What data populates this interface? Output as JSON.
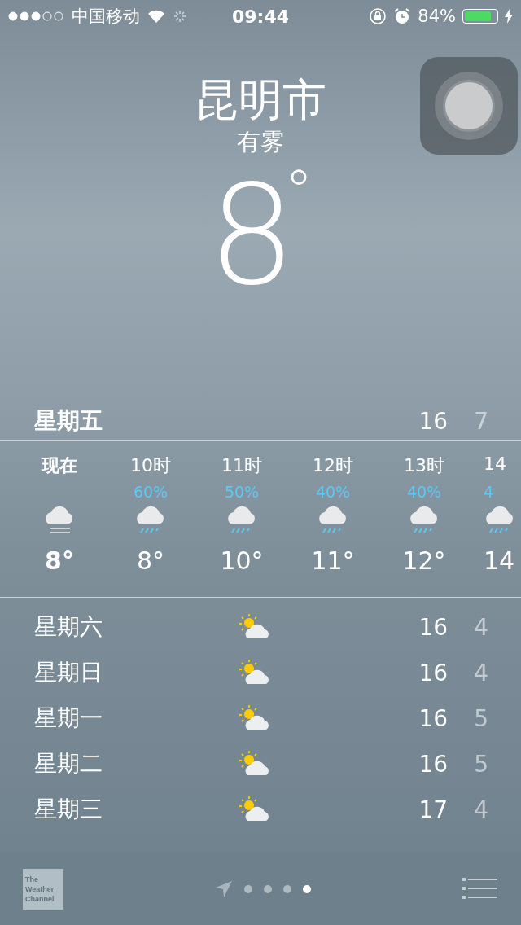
{
  "status_bar": {
    "carrier": "中国移动",
    "time": "09:44",
    "battery": "84%"
  },
  "city": "昆明市",
  "condition": "有雾",
  "temperature": "8",
  "degree": "°",
  "today": {
    "day": "星期五",
    "high": "16",
    "low": "7"
  },
  "hourly": [
    {
      "hour": "现在",
      "now": true,
      "kind": "fog",
      "temp": "8°"
    },
    {
      "hour": "10时",
      "now": false,
      "precip": "60%",
      "kind": "rain",
      "temp": "8°"
    },
    {
      "hour": "11时",
      "now": false,
      "precip": "50%",
      "kind": "rain",
      "temp": "10°"
    },
    {
      "hour": "12时",
      "now": false,
      "precip": "40%",
      "kind": "rain",
      "temp": "11°"
    },
    {
      "hour": "13时",
      "now": false,
      "precip": "40%",
      "kind": "rain",
      "temp": "12°"
    },
    {
      "hour": "14",
      "now": false,
      "precip": "4",
      "kind": "rain",
      "temp": "14"
    }
  ],
  "daily": [
    {
      "day": "星期六",
      "kind": "partly_sunny",
      "high": "16",
      "low": "4"
    },
    {
      "day": "星期日",
      "kind": "partly_sunny",
      "high": "16",
      "low": "4"
    },
    {
      "day": "星期一",
      "kind": "partly_sunny",
      "high": "16",
      "low": "5"
    },
    {
      "day": "星期二",
      "kind": "partly_sunny",
      "high": "16",
      "low": "5"
    },
    {
      "day": "星期三",
      "kind": "partly_sunny",
      "high": "17",
      "low": "4"
    }
  ],
  "footer": {
    "logo": [
      "The",
      "Weather",
      "Channel"
    ],
    "pages": [
      {
        "selected": false
      },
      {
        "selected": false
      },
      {
        "selected": false
      },
      {
        "selected": true
      }
    ]
  }
}
